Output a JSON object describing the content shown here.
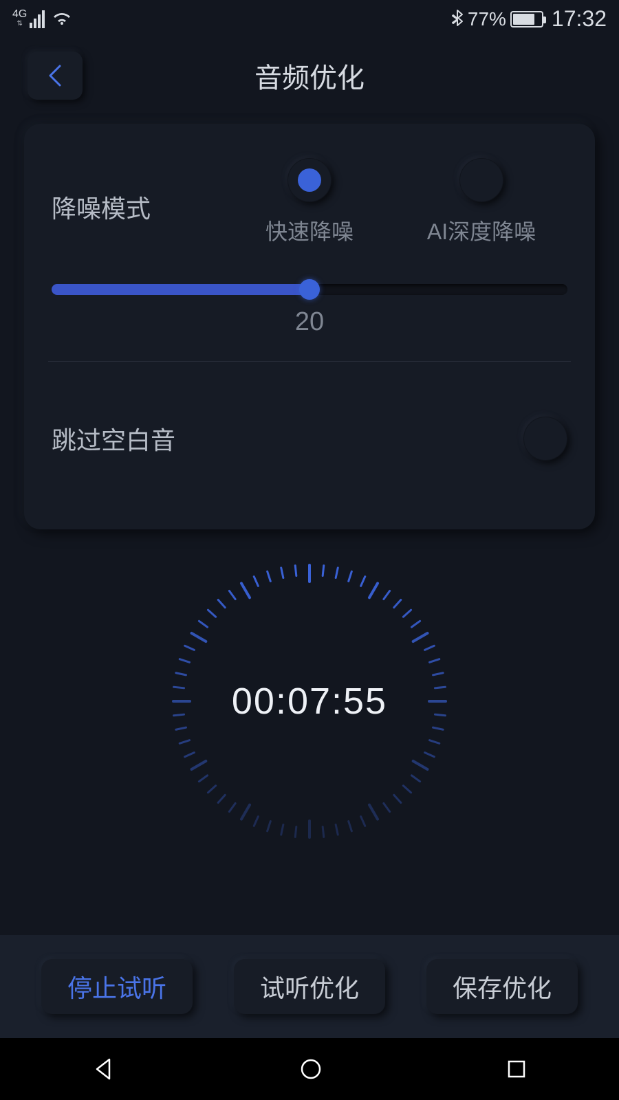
{
  "status": {
    "network": "4G",
    "battery_pct": "77%",
    "time": "17:32"
  },
  "header": {
    "title": "音频优化"
  },
  "card": {
    "noise_mode_label": "降噪模式",
    "option_fast": "快速降噪",
    "option_ai": "AI深度降噪",
    "slider_value": "20",
    "slider_percent": 50,
    "skip_silence_label": "跳过空白音"
  },
  "dial": {
    "time": "00:07:55"
  },
  "actions": {
    "stop_preview": "停止试听",
    "preview_optimize": "试听优化",
    "save_optimize": "保存优化"
  }
}
